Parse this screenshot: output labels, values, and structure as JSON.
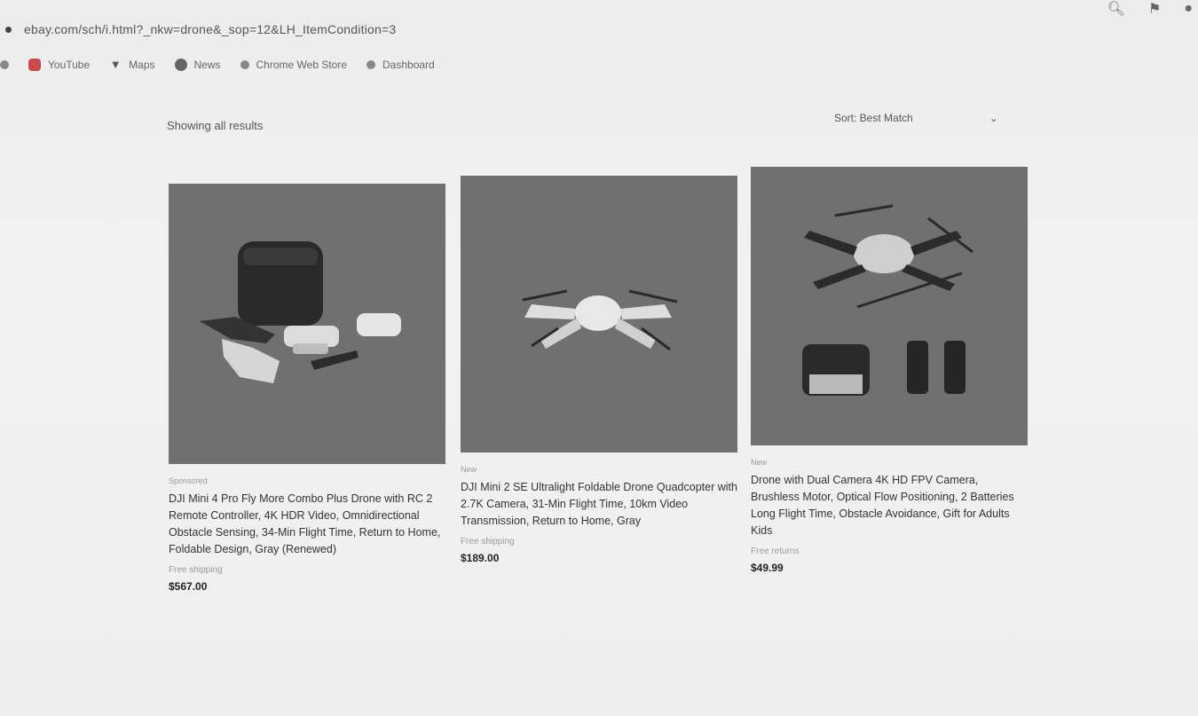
{
  "browser": {
    "url": "ebay.com/sch/i.html?_nkw=drone&_sop=12&LH_ItemCondition=3",
    "bookmarks": [
      {
        "label": "YouTube",
        "icon": "youtube-icon"
      },
      {
        "label": "Maps",
        "icon": "maps-icon"
      },
      {
        "label": "News",
        "icon": "globe-icon"
      },
      {
        "label": "Chrome Web Store",
        "icon": "puzzle-icon"
      },
      {
        "label": "Dashboard",
        "icon": "bookmark-icon"
      }
    ],
    "toolbar_icons": [
      "search-icon",
      "extension-icon",
      "profile-icon"
    ]
  },
  "results": {
    "count_label": "Showing all results",
    "sort_label": "Sort: Best Match"
  },
  "products": [
    {
      "badge": "Sponsored",
      "title": "DJI Mini 4 Pro Fly More Combo Plus Drone with RC 2 Remote Controller, 4K HDR Video, Omnidirectional Obstacle Sensing, 34-Min Flight Time, Return to Home, Foldable Design, Gray (Renewed)",
      "rating": "Free shipping",
      "price": "$567.00"
    },
    {
      "badge": "New",
      "title": "DJI Mini 2 SE Ultralight Foldable Drone Quadcopter with 2.7K Camera, 31-Min Flight Time, 10km Video Transmission, Return to Home, Gray",
      "rating": "Free shipping",
      "price": "$189.00"
    },
    {
      "badge": "New",
      "title": "Drone with Dual Camera 4K HD FPV Camera, Brushless Motor, Optical Flow Positioning, 2 Batteries Long Flight Time, Obstacle Avoidance, Gift for Adults Kids",
      "rating": "Free returns",
      "price": "$49.99"
    }
  ],
  "colors": {
    "page_bg": "#efefef",
    "image_bg": "#707070",
    "text": "#333333"
  }
}
